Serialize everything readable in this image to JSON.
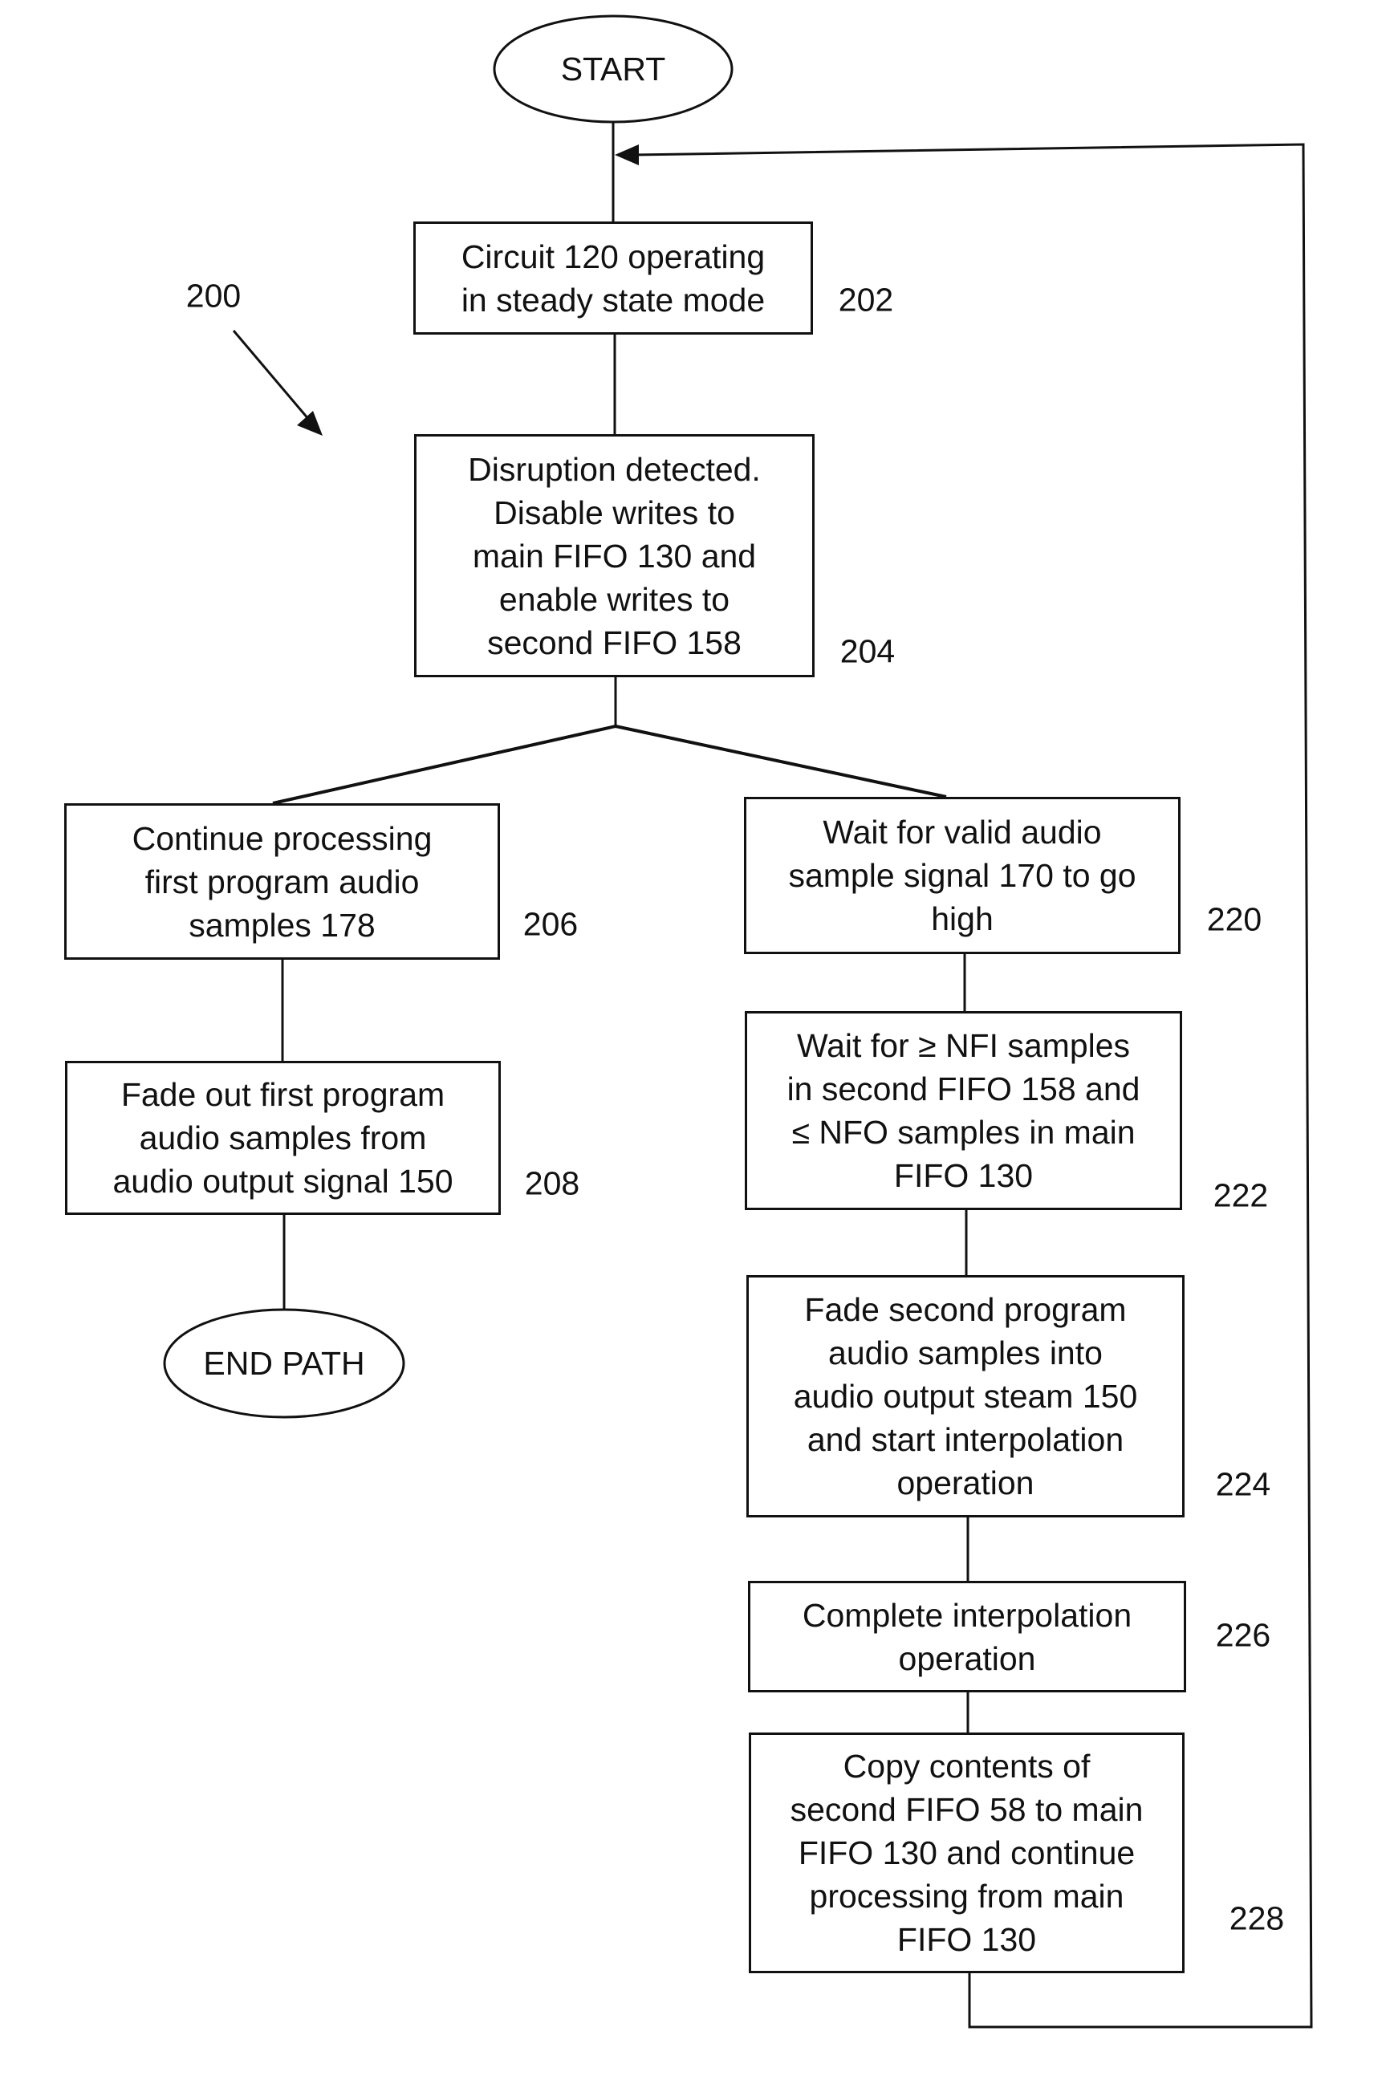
{
  "figure": {
    "id_label": "200",
    "start_label": "START",
    "end_label": "END PATH"
  },
  "steps": [
    {
      "ref": "202",
      "text": "Circuit 120 operating\nin steady state mode"
    },
    {
      "ref": "204",
      "text": "Disruption detected.\nDisable writes to\nmain FIFO 130 and\nenable writes to\nsecond FIFO 158"
    },
    {
      "ref": "206",
      "text": "Continue processing\nfirst program audio\nsamples 178"
    },
    {
      "ref": "208",
      "text": "Fade out first program\naudio samples from\naudio output signal 150"
    },
    {
      "ref": "220",
      "text": "Wait for valid audio\nsample signal 170 to go\nhigh"
    },
    {
      "ref": "222",
      "text": "Wait for ≥ NFI samples\nin second FIFO 158 and\n≤ NFO samples in main\nFIFO 130"
    },
    {
      "ref": "224",
      "text": "Fade second program\naudio samples into\naudio output steam 150\nand start interpolation\noperation"
    },
    {
      "ref": "226",
      "text": "Complete interpolation\noperation"
    },
    {
      "ref": "228",
      "text": "Copy contents of\nsecond FIFO 58 to main\nFIFO 130 and continue\nprocessing from main\nFIFO 130"
    }
  ],
  "colors": {
    "ink": "#111111",
    "background": "#ffffff"
  }
}
